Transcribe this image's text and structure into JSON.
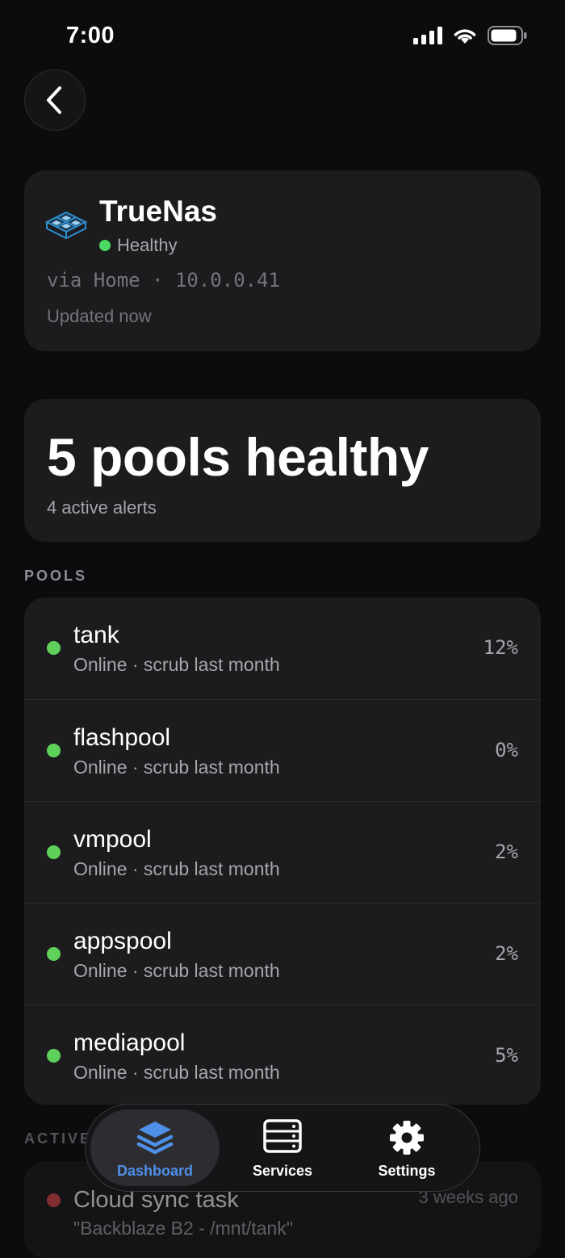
{
  "status_bar": {
    "time": "7:00"
  },
  "server": {
    "name": "TrueNas",
    "status": "Healthy",
    "status_color": "#4cd964",
    "connection": "via Home · 10.0.0.41",
    "updated": "Updated now"
  },
  "summary": {
    "title": "5 pools healthy",
    "subtitle": "4 active alerts"
  },
  "pools_section": {
    "header": "POOLS"
  },
  "pools": [
    {
      "name": "tank",
      "subtitle": "Online · scrub last month",
      "usage": "12%",
      "status_color": "#5fd15a"
    },
    {
      "name": "flashpool",
      "subtitle": "Online · scrub last month",
      "usage": "0%",
      "status_color": "#5fd15a"
    },
    {
      "name": "vmpool",
      "subtitle": "Online · scrub last month",
      "usage": "2%",
      "status_color": "#5fd15a"
    },
    {
      "name": "appspool",
      "subtitle": "Online · scrub last month",
      "usage": "2%",
      "status_color": "#5fd15a"
    },
    {
      "name": "mediapool",
      "subtitle": "Online · scrub last month",
      "usage": "5%",
      "status_color": "#5fd15a"
    }
  ],
  "alerts_section": {
    "header": "ACTIVE ALERTS"
  },
  "alerts": [
    {
      "title": "Cloud sync task",
      "subtitle": "\"Backblaze B2 - /mnt/tank\"",
      "time": "3 weeks ago",
      "status_color": "#e5484d"
    }
  ],
  "tab_bar": {
    "tabs": [
      {
        "label": "Dashboard",
        "icon": "layers-icon",
        "active": true
      },
      {
        "label": "Services",
        "icon": "server-icon",
        "active": false
      },
      {
        "label": "Settings",
        "icon": "gear-icon",
        "active": false
      }
    ]
  },
  "colors": {
    "accent": "#4e8fe8",
    "background": "#0c0c0e",
    "card": "#1c1c1e"
  }
}
